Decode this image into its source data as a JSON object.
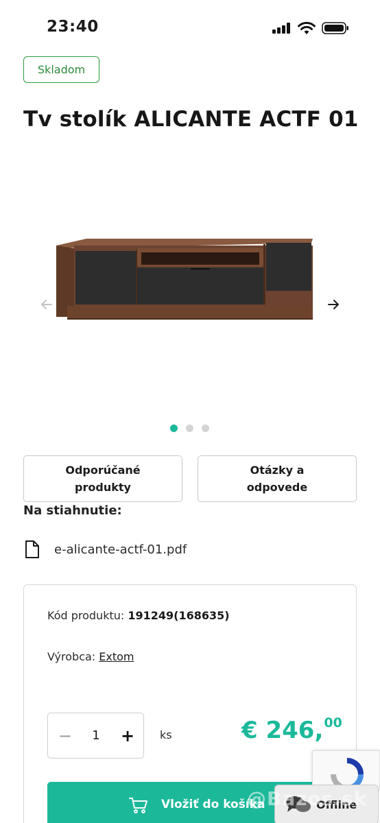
{
  "status_bar": {
    "time": "23:40"
  },
  "product": {
    "stock_label": "Skladom",
    "title": "Tv stolík ALICANTE ACTF 01"
  },
  "carousel": {
    "slide_count": 3,
    "active_index": 0
  },
  "tabs": [
    {
      "label": "Odporúčané produkty"
    },
    {
      "label": "Otázky a odpovede"
    }
  ],
  "downloads": {
    "heading": "Na stiahnutie:",
    "file_name": "e-alicante-actf-01.pdf"
  },
  "details": {
    "code_label": "Kód produktu:",
    "code_value": "191249(168635)",
    "maker_label": "Výrobca:",
    "maker_value": "Extom"
  },
  "purchase": {
    "quantity": "1",
    "unit": "ks",
    "price_main": "€ 246,",
    "price_cents": "00",
    "cart_button_label": "Vložiť do košíka",
    "accent_color": "#1bb99a"
  },
  "chat": {
    "status_label": "Offline"
  },
  "watermark": {
    "text": "@Bazos.sk"
  }
}
